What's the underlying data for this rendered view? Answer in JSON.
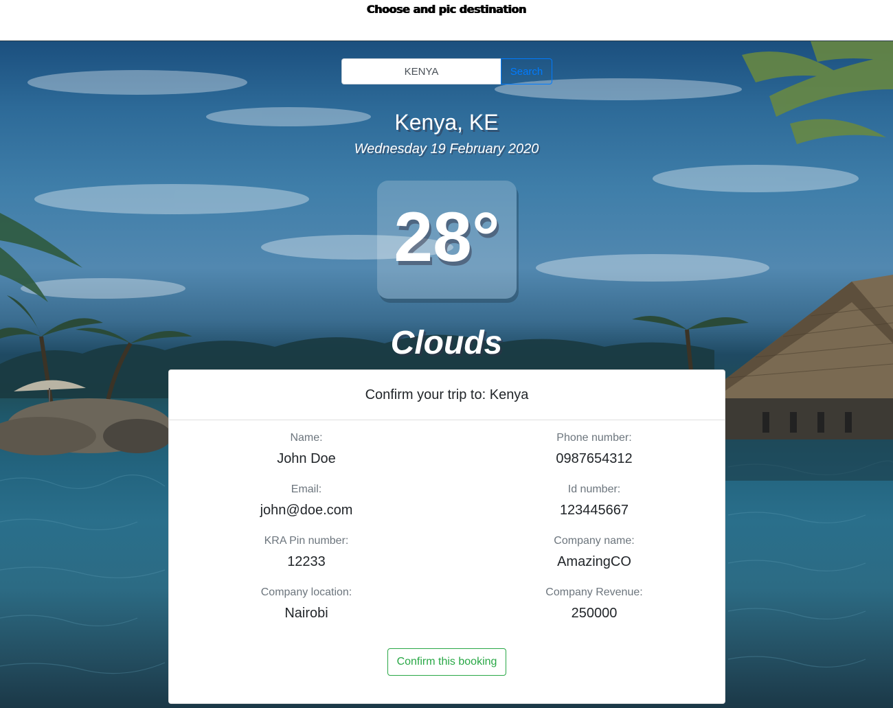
{
  "page": {
    "heading": "Choose and pic destination"
  },
  "search": {
    "value": "KENYA",
    "button_label": "Search"
  },
  "weather": {
    "location": "Kenya, KE",
    "date": "Wednesday 19 February 2020",
    "temperature": "28°",
    "condition": "Clouds"
  },
  "booking": {
    "title": "Confirm your trip to: Kenya",
    "fields": {
      "name": {
        "label": "Name:",
        "value": "John Doe"
      },
      "phone": {
        "label": "Phone number:",
        "value": "0987654312"
      },
      "email": {
        "label": "Email:",
        "value": "john@doe.com"
      },
      "id_number": {
        "label": "Id number:",
        "value": "123445667"
      },
      "kra_pin": {
        "label": "KRA Pin number:",
        "value": "12233"
      },
      "company_name": {
        "label": "Company name:",
        "value": "AmazingCO"
      },
      "company_location": {
        "label": "Company location:",
        "value": "Nairobi"
      },
      "company_revenue": {
        "label": "Company Revenue:",
        "value": "250000"
      }
    },
    "confirm_label": "Confirm this booking"
  },
  "colors": {
    "primary": "#007bff",
    "success": "#28a745",
    "muted": "#6c757d",
    "text": "#212529"
  }
}
